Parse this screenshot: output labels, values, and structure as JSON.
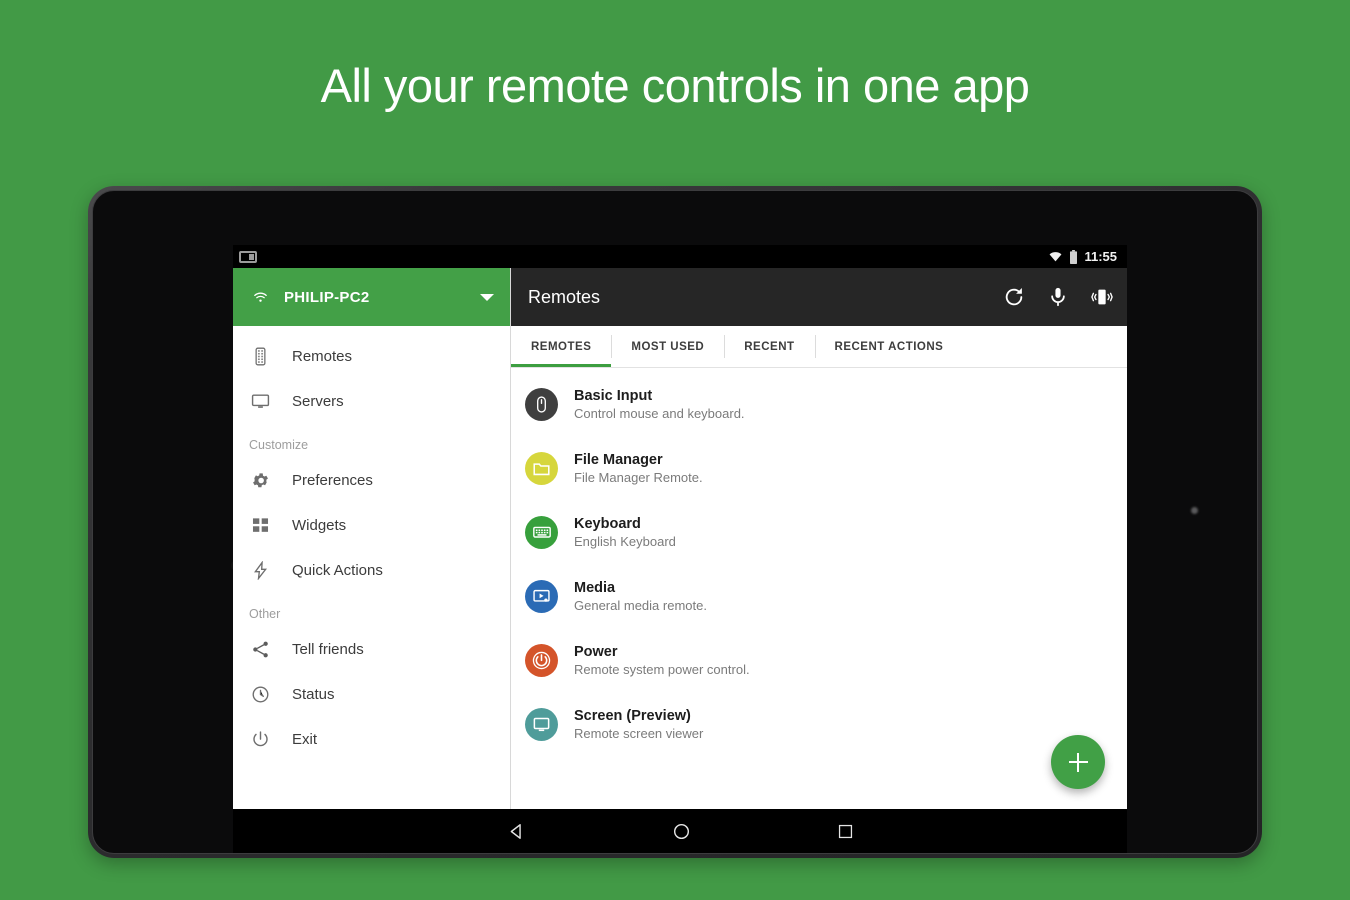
{
  "page": {
    "headline": "All your remote controls in one app",
    "background_color": "#429a46",
    "accent_green": "#43a047"
  },
  "status_bar": {
    "left_icon": "split-screen-icon",
    "wifi_icon": "wifi-icon",
    "battery_icon": "battery-icon",
    "clock": "11:55"
  },
  "drawer": {
    "header": {
      "wifi_icon": "wifi-icon",
      "host": "PHILIP-PC2",
      "caret_icon": "chevron-down-icon"
    },
    "items": [
      {
        "label": "Remotes",
        "icon": "remote-control-icon"
      },
      {
        "label": "Servers",
        "icon": "monitor-icon"
      }
    ],
    "section_customize": "Customize",
    "customize_items": [
      {
        "label": "Preferences",
        "icon": "gear-icon"
      },
      {
        "label": "Widgets",
        "icon": "widgets-icon"
      },
      {
        "label": "Quick Actions",
        "icon": "bolt-icon"
      }
    ],
    "section_other": "Other",
    "other_items": [
      {
        "label": "Tell friends",
        "icon": "share-icon"
      },
      {
        "label": "Status",
        "icon": "clock-icon"
      },
      {
        "label": "Exit",
        "icon": "power-icon"
      }
    ]
  },
  "toolbar": {
    "title": "Remotes",
    "refresh_icon": "refresh-icon",
    "mic_icon": "microphone-icon",
    "vibrate_icon": "vibrate-phone-icon"
  },
  "tabs": [
    {
      "label": "REMOTES",
      "active": true
    },
    {
      "label": "MOST USED",
      "active": false
    },
    {
      "label": "RECENT",
      "active": false
    },
    {
      "label": "RECENT ACTIONS",
      "active": false
    }
  ],
  "remotes": [
    {
      "title": "Basic Input",
      "subtitle": "Control mouse and keyboard.",
      "icon": "mouse-icon",
      "color": "#3f3f3f"
    },
    {
      "title": "File Manager",
      "subtitle": "File Manager Remote.",
      "icon": "folder-icon",
      "color": "#d6d63c"
    },
    {
      "title": "Keyboard",
      "subtitle": "English Keyboard",
      "icon": "keyboard-icon",
      "color": "#37a03c"
    },
    {
      "title": "Media",
      "subtitle": "General media remote.",
      "icon": "media-icon",
      "color": "#2b6bb5"
    },
    {
      "title": "Power",
      "subtitle": "Remote system power control.",
      "icon": "power-icon",
      "color": "#d4542a"
    },
    {
      "title": "Screen (Preview)",
      "subtitle": "Remote screen viewer",
      "icon": "screen-icon",
      "color": "#4f9c9a"
    }
  ],
  "fab": {
    "label": "+",
    "icon": "add-icon",
    "color": "#41a046"
  },
  "nav_bar": {
    "back_icon": "back-triangle-icon",
    "home_icon": "home-circle-icon",
    "recents_icon": "recents-square-icon"
  }
}
